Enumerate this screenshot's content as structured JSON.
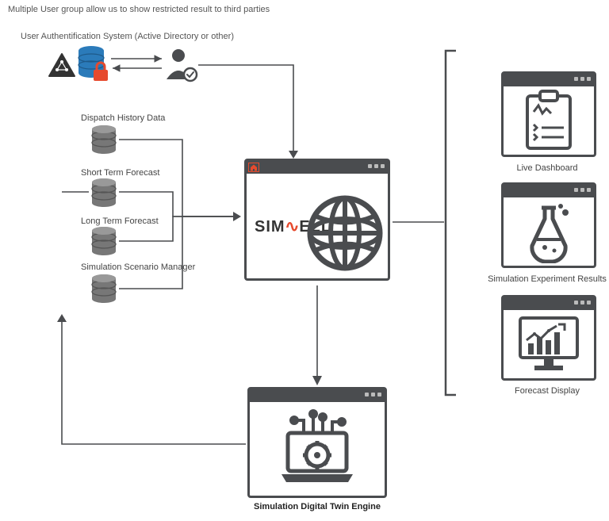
{
  "header": {
    "title": "Multiple User group allow us to show restricted result to third parties",
    "auth_label": "User Authentification System (Active Directory or other)"
  },
  "data_sources": {
    "dispatch": "Dispatch History Data",
    "short_term": "Short Term Forecast",
    "long_term": "Long Term Forecast",
    "scenario": "Simulation Scenario Manager"
  },
  "center": {
    "brand": "SIMWELL"
  },
  "engine": {
    "label": "Simulation Digital Twin Engine"
  },
  "outputs": {
    "dashboard": "Live Dashboard",
    "experiment": "Simulation Experiment Results",
    "forecast": "Forecast Display"
  }
}
